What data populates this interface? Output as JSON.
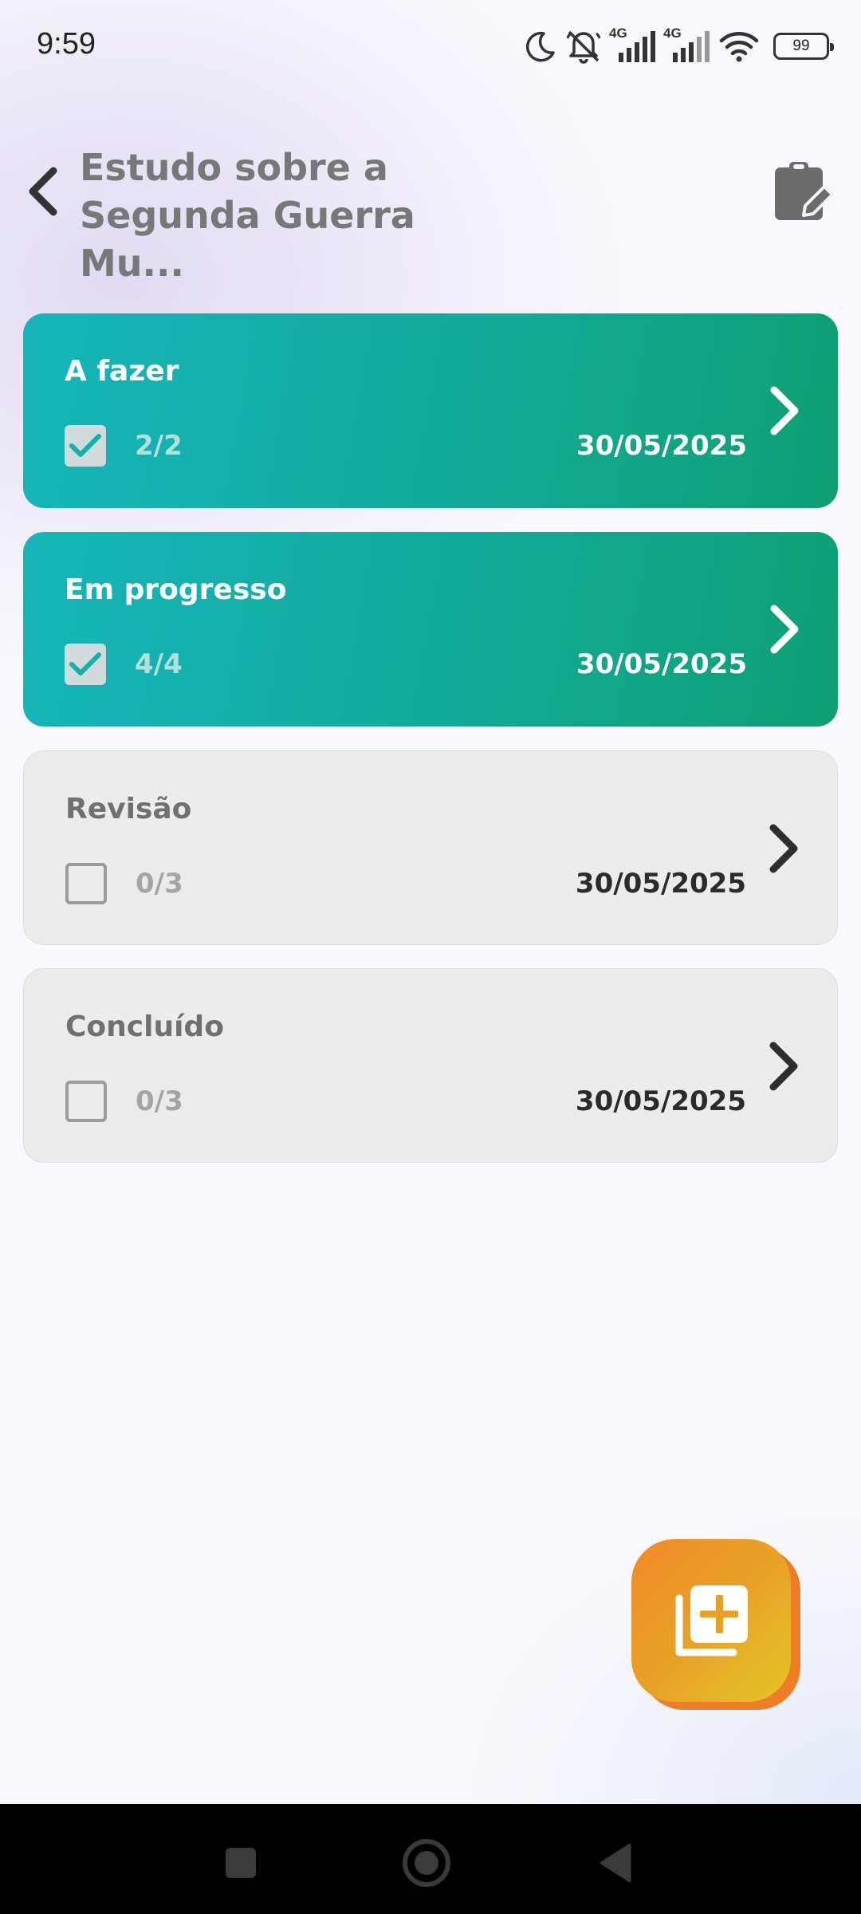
{
  "status_bar": {
    "time": "9:59",
    "network_1": "4G",
    "network_2": "4G",
    "battery": "99",
    "icons": [
      "moon-icon",
      "bell-off-icon",
      "signal-icon",
      "signal-icon",
      "wifi-icon",
      "battery-icon"
    ]
  },
  "header": {
    "title_line1": "Estudo sobre a",
    "title_line2": "Segunda Guerra Mu...",
    "back_icon": "chevron-left-icon",
    "notes_icon": "clipboard-edit-icon"
  },
  "cards": [
    {
      "title": "A fazer",
      "count": "2/2",
      "date": "30/05/2025",
      "checked": true
    },
    {
      "title": "Em progresso",
      "count": "4/4",
      "date": "30/05/2025",
      "checked": true
    },
    {
      "title": "Revisão",
      "count": "0/3",
      "date": "30/05/2025",
      "checked": false
    },
    {
      "title": "Concluído",
      "count": "0/3",
      "date": "30/05/2025",
      "checked": false
    }
  ],
  "fab": {
    "icon": "library-add-icon"
  },
  "colors": {
    "active_card_start": "#17b5ba",
    "active_card_end": "#0e9f72",
    "idle_card": "#ececec",
    "fab_start": "#f08a28",
    "fab_end": "#e1c628",
    "check_mark": "#14b0aa"
  },
  "nav_bar": {
    "icons": [
      "recents-square-icon",
      "home-circle-icon",
      "back-triangle-icon"
    ]
  }
}
